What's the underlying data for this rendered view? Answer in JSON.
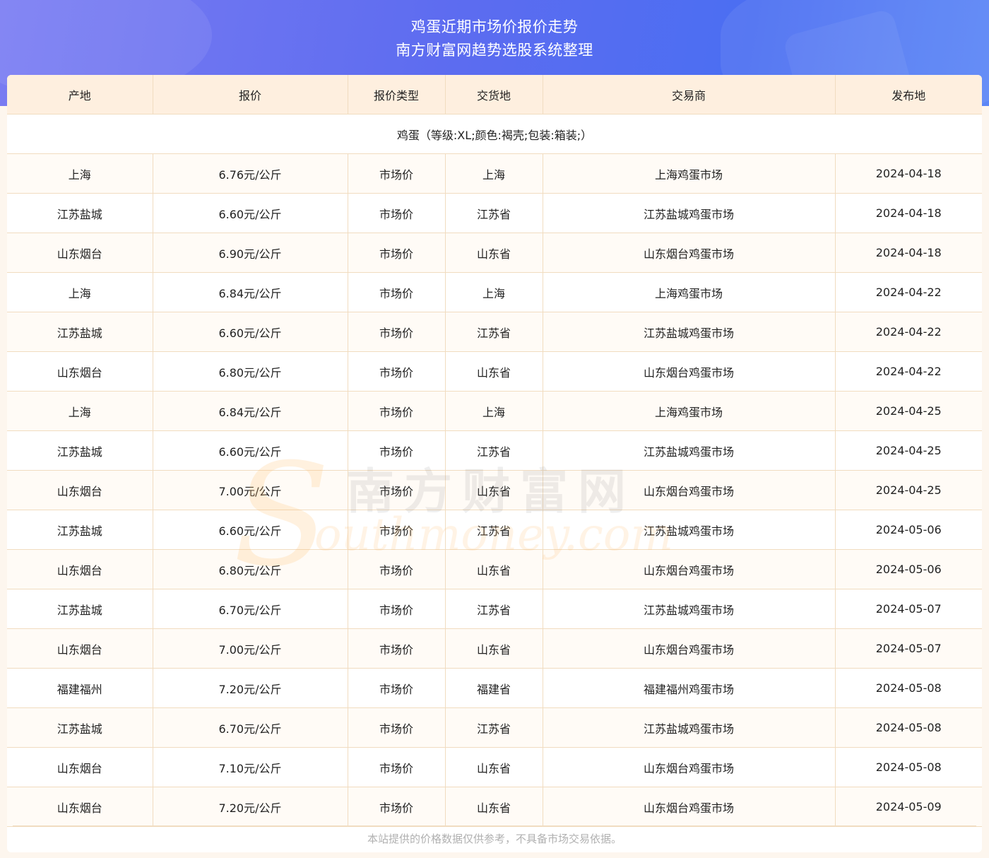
{
  "header": {
    "title": "鸡蛋近期市场价报价走势",
    "subtitle": "南方财富网趋势选股系统整理"
  },
  "table": {
    "columns": [
      "产地",
      "报价",
      "报价类型",
      "交货地",
      "交易商",
      "发布地"
    ],
    "group_label": "鸡蛋（等级:XL;颜色:褐壳;包装:箱装;）",
    "rows": [
      [
        "上海",
        "6.76元/公斤",
        "市场价",
        "上海",
        "上海鸡蛋市场",
        "2024-04-18"
      ],
      [
        "江苏盐城",
        "6.60元/公斤",
        "市场价",
        "江苏省",
        "江苏盐城鸡蛋市场",
        "2024-04-18"
      ],
      [
        "山东烟台",
        "6.90元/公斤",
        "市场价",
        "山东省",
        "山东烟台鸡蛋市场",
        "2024-04-18"
      ],
      [
        "上海",
        "6.84元/公斤",
        "市场价",
        "上海",
        "上海鸡蛋市场",
        "2024-04-22"
      ],
      [
        "江苏盐城",
        "6.60元/公斤",
        "市场价",
        "江苏省",
        "江苏盐城鸡蛋市场",
        "2024-04-22"
      ],
      [
        "山东烟台",
        "6.80元/公斤",
        "市场价",
        "山东省",
        "山东烟台鸡蛋市场",
        "2024-04-22"
      ],
      [
        "上海",
        "6.84元/公斤",
        "市场价",
        "上海",
        "上海鸡蛋市场",
        "2024-04-25"
      ],
      [
        "江苏盐城",
        "6.60元/公斤",
        "市场价",
        "江苏省",
        "江苏盐城鸡蛋市场",
        "2024-04-25"
      ],
      [
        "山东烟台",
        "7.00元/公斤",
        "市场价",
        "山东省",
        "山东烟台鸡蛋市场",
        "2024-04-25"
      ],
      [
        "江苏盐城",
        "6.60元/公斤",
        "市场价",
        "江苏省",
        "江苏盐城鸡蛋市场",
        "2024-05-06"
      ],
      [
        "山东烟台",
        "6.80元/公斤",
        "市场价",
        "山东省",
        "山东烟台鸡蛋市场",
        "2024-05-06"
      ],
      [
        "江苏盐城",
        "6.70元/公斤",
        "市场价",
        "江苏省",
        "江苏盐城鸡蛋市场",
        "2024-05-07"
      ],
      [
        "山东烟台",
        "7.00元/公斤",
        "市场价",
        "山东省",
        "山东烟台鸡蛋市场",
        "2024-05-07"
      ],
      [
        "福建福州",
        "7.20元/公斤",
        "市场价",
        "福建省",
        "福建福州鸡蛋市场",
        "2024-05-08"
      ],
      [
        "江苏盐城",
        "6.70元/公斤",
        "市场价",
        "江苏省",
        "江苏盐城鸡蛋市场",
        "2024-05-08"
      ],
      [
        "山东烟台",
        "7.10元/公斤",
        "市场价",
        "山东省",
        "山东烟台鸡蛋市场",
        "2024-05-08"
      ],
      [
        "山东烟台",
        "7.20元/公斤",
        "市场价",
        "山东省",
        "山东烟台鸡蛋市场",
        "2024-05-09"
      ]
    ]
  },
  "footer": {
    "disclaimer": "本站提供的价格数据仅供参考，不具备市场交易依据。"
  },
  "watermark": {
    "letter": "S",
    "cn_text": "南方财富网",
    "en_text": "outhmoney.com"
  },
  "colors": {
    "banner_start": "#7a7cf2",
    "banner_end": "#4b6ef2",
    "header_row_bg": "#feefdf",
    "border": "#f1dcc0",
    "page_bg": "#fdf6ee"
  }
}
